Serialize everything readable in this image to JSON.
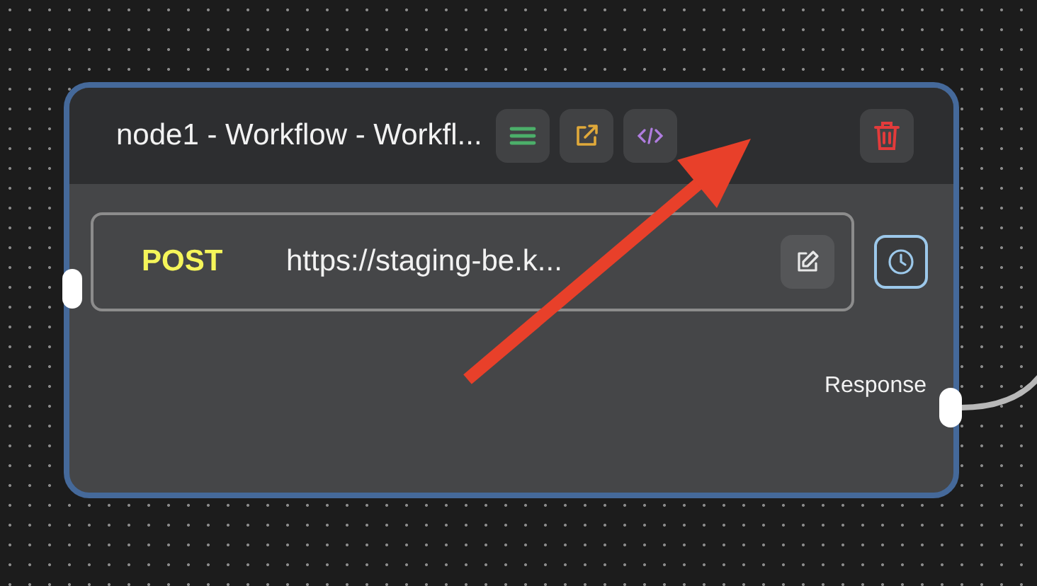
{
  "node": {
    "title": "node1 - Workflow - Workfl...",
    "request": {
      "method": "POST",
      "url": "https://staging-be.k..."
    },
    "output": {
      "label": "Response"
    }
  }
}
